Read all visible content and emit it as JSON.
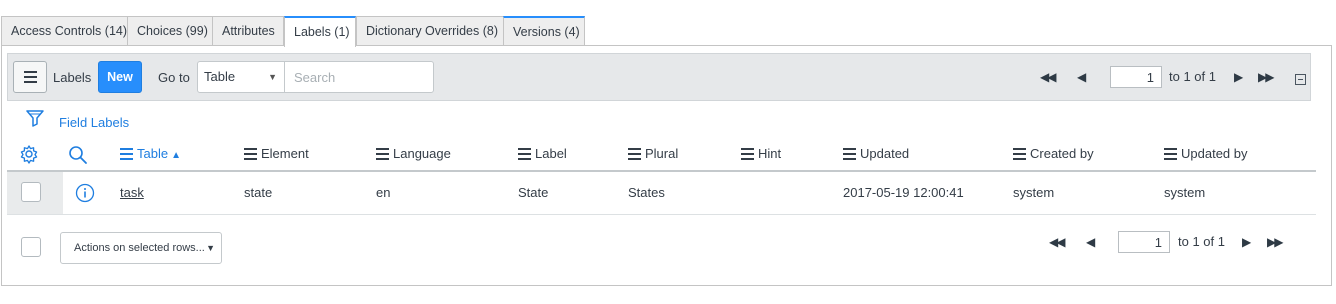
{
  "tabs": [
    {
      "label": "Access Controls (14)"
    },
    {
      "label": "Choices (99)"
    },
    {
      "label": "Attributes"
    },
    {
      "label": "Labels (1)"
    },
    {
      "label": "Dictionary Overrides (8)"
    },
    {
      "label": "Versions (4)"
    }
  ],
  "toolbar": {
    "list_title": "Labels",
    "new_label": "New",
    "goto_label": "Go to",
    "goto_selected": "Table",
    "search_placeholder": "Search",
    "page_value": "1",
    "page_range": "to 1 of 1"
  },
  "breadcrumb": "Field Labels",
  "columns": {
    "table": "Table",
    "element": "Element",
    "language": "Language",
    "label": "Label",
    "plural": "Plural",
    "hint": "Hint",
    "updated": "Updated",
    "created_by": "Created by",
    "updated_by": "Updated by"
  },
  "sort": {
    "column": "Table",
    "direction": "ascending"
  },
  "rows": [
    {
      "table": "task",
      "element": "state",
      "language": "en",
      "label": "State",
      "plural": "States",
      "hint": "",
      "updated": "2017-05-19 12:00:41",
      "created_by": "system",
      "updated_by": "system"
    }
  ],
  "footer": {
    "actions_label": "Actions on selected rows...",
    "page_value": "1",
    "page_range": "to 1 of 1"
  },
  "colors": {
    "accent": "#278efc",
    "link": "#1f7ee0",
    "toolbar_bg": "#e6e8ea"
  },
  "icons": [
    "hamburger-icon",
    "filter-icon",
    "gear-icon",
    "search-icon",
    "info-icon",
    "first-page-icon",
    "prev-page-icon",
    "next-page-icon",
    "last-page-icon",
    "collapse-icon"
  ]
}
